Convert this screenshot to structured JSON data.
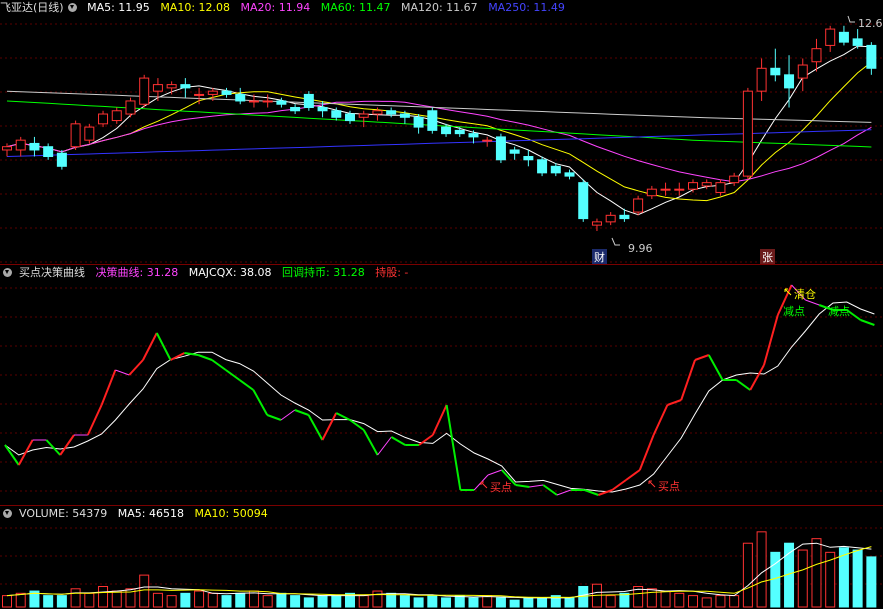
{
  "price_panel": {
    "title": "飞亚达(日线)",
    "ma": [
      {
        "label": "MA5: 11.95",
        "color": "#ffffff"
      },
      {
        "label": "MA10: 12.08",
        "color": "#ffff00"
      },
      {
        "label": "MA20: 11.94",
        "color": "#ff44ff"
      },
      {
        "label": "MA60: 11.47",
        "color": "#00ff00"
      },
      {
        "label": "MA120: 11.67",
        "color": "#cccccc"
      },
      {
        "label": "MA250: 11.49",
        "color": "#3333ff"
      }
    ],
    "high_label": "12.6",
    "low_label": "9.96",
    "badge_cai": "财",
    "badge_zhang": "张"
  },
  "indicator_panel": {
    "title": "买点决策曲线",
    "items": [
      {
        "label": "决策曲线: 31.28",
        "color": "#ff44ff"
      },
      {
        "label": "MAJCQX: 38.08",
        "color": "#ffffff"
      },
      {
        "label": "回调持币: 31.28",
        "color": "#00ff00"
      },
      {
        "label": "持股: -",
        "color": "#ff3333"
      }
    ],
    "signals": {
      "buy1": "买点",
      "buy2": "买点",
      "clear": "清仓",
      "reduce1": "减点",
      "reduce2": "减点"
    }
  },
  "volume_panel": {
    "title": "VOLUME: 54379",
    "items": [
      {
        "label": "MA5: 46518",
        "color": "#ffffff"
      },
      {
        "label": "MA10: 50094",
        "color": "#ffff00"
      }
    ]
  },
  "chart_data": {
    "type": "candlestick",
    "ohlc": [
      [
        11.2,
        11.3,
        11.1,
        11.25
      ],
      [
        11.2,
        11.4,
        11.1,
        11.35
      ],
      [
        11.3,
        11.4,
        11.1,
        11.2
      ],
      [
        11.25,
        11.3,
        11.05,
        11.1
      ],
      [
        11.15,
        11.2,
        10.9,
        10.95
      ],
      [
        11.25,
        11.65,
        11.2,
        11.6
      ],
      [
        11.35,
        11.6,
        11.3,
        11.55
      ],
      [
        11.6,
        11.8,
        11.55,
        11.75
      ],
      [
        11.65,
        11.85,
        11.6,
        11.8
      ],
      [
        11.75,
        12.0,
        11.7,
        11.95
      ],
      [
        11.9,
        12.35,
        11.85,
        12.3
      ],
      [
        12.1,
        12.3,
        11.95,
        12.2
      ],
      [
        12.15,
        12.25,
        12.05,
        12.2
      ],
      [
        12.2,
        12.3,
        12.0,
        12.15
      ],
      [
        12.05,
        12.15,
        11.9,
        12.05
      ],
      [
        12.05,
        12.15,
        11.95,
        12.1
      ],
      [
        12.1,
        12.15,
        12.0,
        12.05
      ],
      [
        12.05,
        12.15,
        11.9,
        11.95
      ],
      [
        11.95,
        12.05,
        11.85,
        11.95
      ],
      [
        11.95,
        12.05,
        11.85,
        11.95
      ],
      [
        11.95,
        12.0,
        11.85,
        11.9
      ],
      [
        11.85,
        11.9,
        11.75,
        11.8
      ],
      [
        12.05,
        12.1,
        11.8,
        11.85
      ],
      [
        11.85,
        11.95,
        11.7,
        11.8
      ],
      [
        11.8,
        11.85,
        11.65,
        11.7
      ],
      [
        11.75,
        11.8,
        11.6,
        11.65
      ],
      [
        11.7,
        11.8,
        11.55,
        11.75
      ],
      [
        11.75,
        11.85,
        11.65,
        11.8
      ],
      [
        11.8,
        11.85,
        11.7,
        11.75
      ],
      [
        11.75,
        11.8,
        11.6,
        11.7
      ],
      [
        11.7,
        11.75,
        11.45,
        11.55
      ],
      [
        11.8,
        11.85,
        11.45,
        11.5
      ],
      [
        11.55,
        11.6,
        11.4,
        11.45
      ],
      [
        11.5,
        11.55,
        11.4,
        11.45
      ],
      [
        11.45,
        11.5,
        11.3,
        11.4
      ],
      [
        11.35,
        11.4,
        11.25,
        11.35
      ],
      [
        11.4,
        11.45,
        11.0,
        11.05
      ],
      [
        11.2,
        11.25,
        11.05,
        11.15
      ],
      [
        11.1,
        11.2,
        10.95,
        11.05
      ],
      [
        11.05,
        11.1,
        10.8,
        10.85
      ],
      [
        10.95,
        11.0,
        10.8,
        10.85
      ],
      [
        10.85,
        10.9,
        10.75,
        10.8
      ],
      [
        10.7,
        10.75,
        10.1,
        10.15
      ],
      [
        10.05,
        10.15,
        9.96,
        10.1
      ],
      [
        10.1,
        10.25,
        10.05,
        10.2
      ],
      [
        10.2,
        10.3,
        10.1,
        10.15
      ],
      [
        10.25,
        10.5,
        10.2,
        10.45
      ],
      [
        10.5,
        10.65,
        10.45,
        10.6
      ],
      [
        10.6,
        10.7,
        10.5,
        10.6
      ],
      [
        10.6,
        10.7,
        10.5,
        10.6
      ],
      [
        10.6,
        10.75,
        10.55,
        10.7
      ],
      [
        10.65,
        10.75,
        10.6,
        10.7
      ],
      [
        10.55,
        10.75,
        10.5,
        10.7
      ],
      [
        10.7,
        10.85,
        10.65,
        10.8
      ],
      [
        10.8,
        12.15,
        10.75,
        12.1
      ],
      [
        12.1,
        12.6,
        11.95,
        12.45
      ],
      [
        12.45,
        12.75,
        12.25,
        12.35
      ],
      [
        12.35,
        12.65,
        11.85,
        12.15
      ],
      [
        12.3,
        12.6,
        12.1,
        12.5
      ],
      [
        12.55,
        12.9,
        12.4,
        12.75
      ],
      [
        12.8,
        13.1,
        12.7,
        13.05
      ],
      [
        13.0,
        13.1,
        12.8,
        12.85
      ],
      [
        12.9,
        13.05,
        12.75,
        12.8
      ],
      [
        12.8,
        12.85,
        12.35,
        12.45
      ]
    ],
    "ma_series": [
      "MA5",
      "MA10",
      "MA20",
      "MA60",
      "MA120",
      "MA250"
    ],
    "volume": [
      5,
      6,
      7,
      5,
      5,
      8,
      6,
      9,
      7,
      8,
      14,
      6,
      5,
      6,
      7,
      6,
      5,
      6,
      7,
      5,
      6,
      5,
      4,
      5,
      5,
      6,
      5,
      7,
      6,
      5,
      4,
      5,
      4,
      5,
      4,
      5,
      4,
      3,
      4,
      4,
      5,
      4,
      9,
      10,
      5,
      6,
      9,
      8,
      7,
      6,
      5,
      4,
      5,
      5,
      28,
      33,
      24,
      28,
      25,
      30,
      24,
      26,
      25,
      22
    ]
  }
}
